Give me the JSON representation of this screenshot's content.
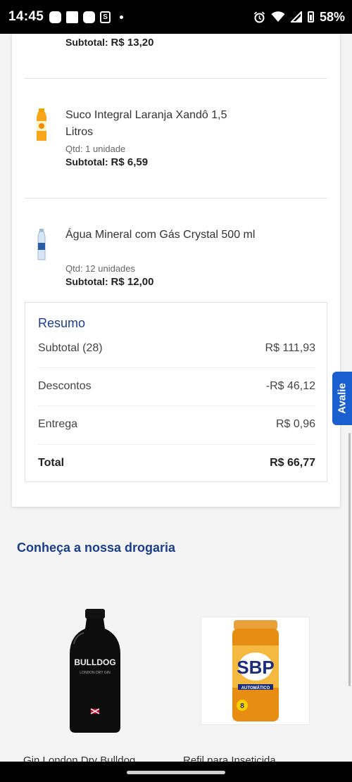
{
  "status_bar": {
    "time": "14:45",
    "shop_glyph": "S",
    "battery": "58%"
  },
  "order_items": [
    {
      "name": "",
      "qty": "",
      "subtotal_label": "Subtotal:",
      "subtotal_value": "R$ 13,20"
    },
    {
      "name": "Suco Integral Laranja Xandô 1,5 Litros",
      "qty": "Qtd: 1 unidade",
      "subtotal_label": "Subtotal:",
      "subtotal_value": "R$ 6,59"
    },
    {
      "name": "Água Mineral com Gás Crystal 500 ml",
      "qty": "Qtd: 12 unidades",
      "subtotal_label": "Subtotal:",
      "subtotal_value": "R$ 12,00"
    }
  ],
  "summary": {
    "title": "Resumo",
    "subtotal_label": "Subtotal (28)",
    "subtotal_value": "R$ 111,93",
    "discount_label": "Descontos",
    "discount_value": "-R$ 46,12",
    "delivery_label": "Entrega",
    "delivery_value": "R$ 0,96",
    "total_label": "Total",
    "total_value": "R$ 66,77"
  },
  "drugstore": {
    "title": "Conheça a nossa drogaria",
    "products": [
      {
        "name": "Gin London Dry Bulldog",
        "brand_text": "BULLDOG",
        "sub_text": "LONDON DRY GIN"
      },
      {
        "name": "Refil para Inseticida",
        "brand_text": "SBP",
        "sub_text": "AUTOMÁTICO",
        "badge": "8"
      }
    ]
  },
  "feedback_tab": {
    "label": "Avalie"
  },
  "colors": {
    "accent": "#1a3e8c",
    "feedback": "#1a5fd0"
  },
  "icons": [
    "alarm-icon",
    "wifi-icon",
    "signal-icon",
    "battery-icon"
  ]
}
